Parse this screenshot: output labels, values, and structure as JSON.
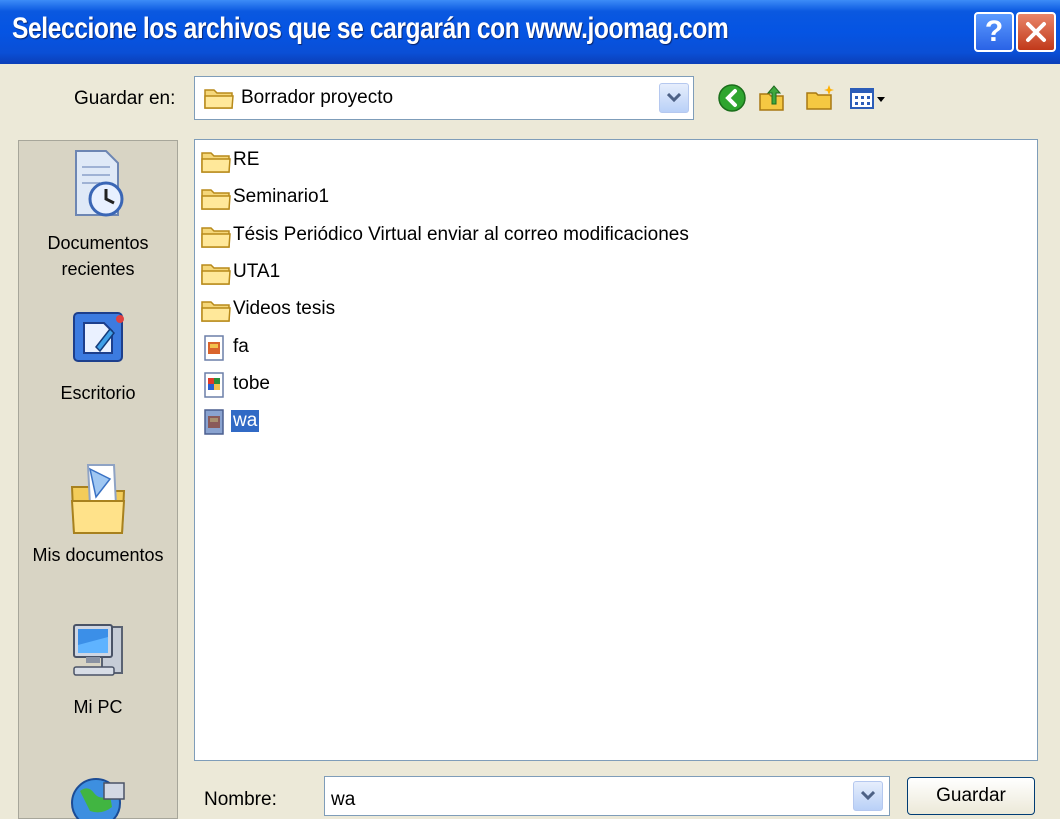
{
  "window": {
    "title": "Seleccione los archivos que se cargarán con www.joomag.com",
    "help_label": "?"
  },
  "toolbar": {
    "save_in_label": "Guardar en:",
    "current_folder": "Borrador proyecto",
    "icons": [
      "back-icon",
      "up-folder-icon",
      "new-folder-icon",
      "view-menu-icon"
    ]
  },
  "places": [
    {
      "label": "Documentos recientes",
      "icon": "recent-documents-icon"
    },
    {
      "label": "Escritorio",
      "icon": "desktop-icon"
    },
    {
      "label": "Mis documentos",
      "icon": "my-documents-icon"
    },
    {
      "label": "Mi PC",
      "icon": "my-computer-icon"
    },
    {
      "label": "",
      "icon": "network-places-icon"
    }
  ],
  "files": [
    {
      "name": "RE",
      "type": "folder"
    },
    {
      "name": "Seminario1",
      "type": "folder"
    },
    {
      "name": "Tésis Periódico Virtual enviar al correo modificaciones",
      "type": "folder"
    },
    {
      "name": "UTA1",
      "type": "folder"
    },
    {
      "name": "Videos tesis",
      "type": "folder"
    },
    {
      "name": "fa",
      "type": "file"
    },
    {
      "name": "tobe",
      "type": "image"
    },
    {
      "name": "wa",
      "type": "file",
      "selected": true
    }
  ],
  "filename": {
    "label": "Nombre:",
    "value": "wa"
  },
  "buttons": {
    "save_label": "Guardar"
  },
  "colors": {
    "titlebar": "#0554e3",
    "selection": "#316ac5",
    "dialog_bg": "#ece9d8"
  }
}
